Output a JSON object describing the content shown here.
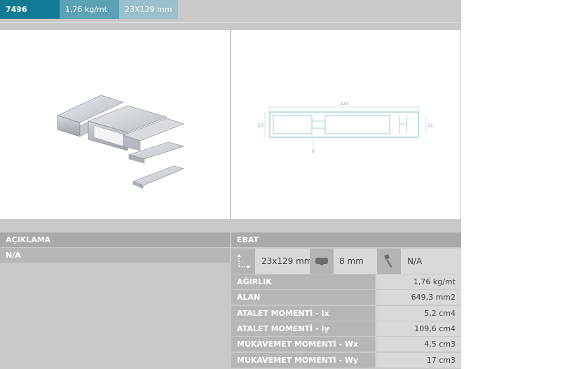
{
  "header": {
    "code": "7496",
    "weight": "1,76 kg/mt",
    "dimensions": "23X129 mm"
  },
  "drawing": {
    "width_label": "129",
    "height_label": "23",
    "slot_label": "11",
    "small_label": "8"
  },
  "description": {
    "heading": "AÇIKLAMA",
    "value": "N/A"
  },
  "ebat": {
    "heading": "EBAT",
    "items": [
      {
        "icon": "dimension-icon",
        "value": "23x129 mm"
      },
      {
        "icon": "gasket-icon",
        "value": "8 mm"
      },
      {
        "icon": "screw-icon",
        "value": "N/A"
      }
    ]
  },
  "properties": [
    {
      "label": "AĞIRLIK",
      "value": "1,76 kg/mt"
    },
    {
      "label": "ALAN",
      "value": "649,3 mm2"
    },
    {
      "label": "ATALET MOMENTİ - Ix",
      "value": "5,2 cm4"
    },
    {
      "label": "ATALET MOMENTİ - Iy",
      "value": "109,6 cm4"
    },
    {
      "label": "MUKAVEMET MOMENTİ - Wx",
      "value": "4,5 cm3"
    },
    {
      "label": "MUKAVEMET MOMENTİ - Wy",
      "value": "17 cm3"
    }
  ],
  "colors": {
    "tab_primary": "#117b96",
    "tab_secondary": "#5ba2b5",
    "tab_tertiary": "#9bbfcc",
    "panel_bg": "#c8c8c8"
  }
}
